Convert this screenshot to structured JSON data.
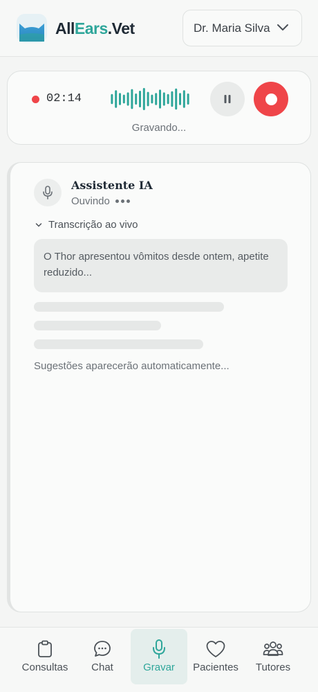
{
  "header": {
    "logo_part1": "All",
    "logo_part2": "Ears",
    "logo_part3": ".Vet",
    "user_name": "Dr. Maria Silva"
  },
  "recorder": {
    "timer": "02:14",
    "status": "Gravando...",
    "wave_bars": [
      0.45,
      0.8,
      0.55,
      0.4,
      0.6,
      0.9,
      0.5,
      0.75,
      1.0,
      0.65,
      0.4,
      0.55,
      0.85,
      0.6,
      0.45,
      0.7,
      0.95,
      0.55,
      0.8,
      0.5
    ]
  },
  "assistant": {
    "name": "Assistente IA",
    "status": "Ouvindo",
    "transcript_label": "Transcrição ao vivo",
    "transcript_text": "O Thor apresentou vômitos desde ontem, apetite reduzido...",
    "suggestions_placeholder": "Sugestões aparecerão automaticamente..."
  },
  "nav": {
    "items": [
      {
        "label": "Consultas",
        "icon": "clipboard-icon"
      },
      {
        "label": "Chat",
        "icon": "chat-bubble-icon"
      },
      {
        "label": "Gravar",
        "icon": "microphone-icon",
        "active": true
      },
      {
        "label": "Pacientes",
        "icon": "heart-icon"
      },
      {
        "label": "Tutores",
        "icon": "users-icon"
      }
    ]
  },
  "colors": {
    "accent": "#2ea69a",
    "record_red": "#ef4549",
    "logo_blue": "#3a9bd0"
  }
}
